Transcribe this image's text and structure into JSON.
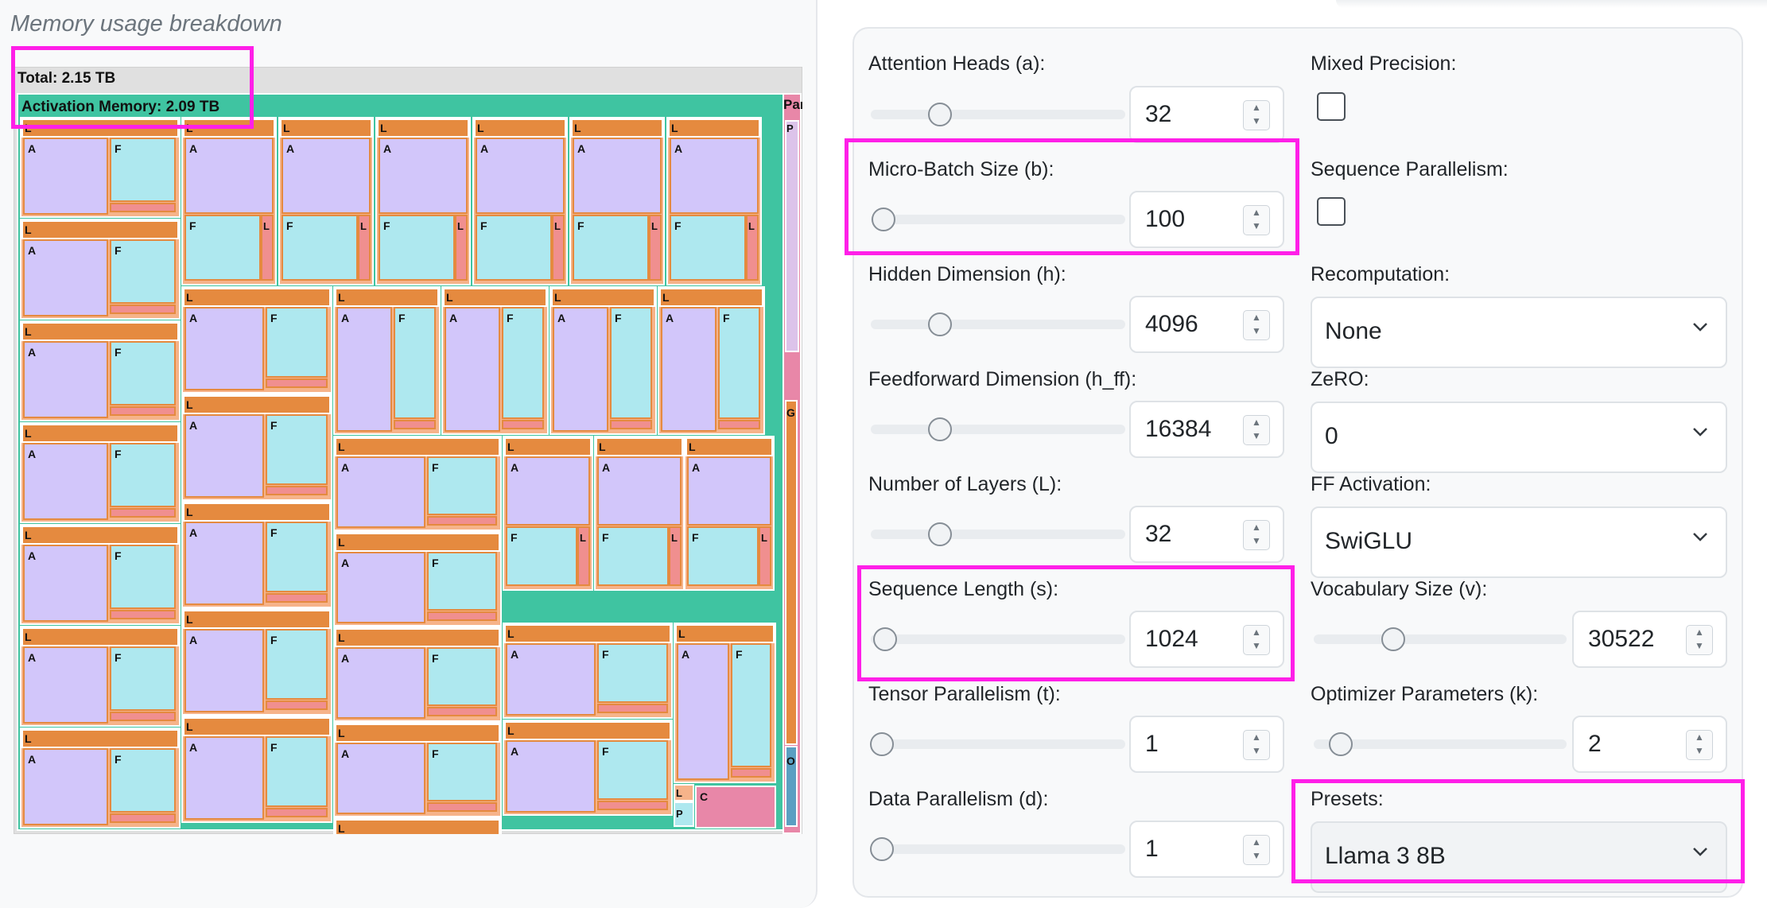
{
  "memory_panel": {
    "title": "Memory usage breakdown",
    "total_label": "Total: 2.15 TB",
    "activation_label": "Activation Memory: 2.09 TB",
    "param_label": "Par",
    "param_sub_label": "P",
    "grad_label": "G",
    "opt_label": "O",
    "layer_letter": "L",
    "attn_letter": "A",
    "ff_letter": "F",
    "c_letter": "C",
    "p_letter": "P"
  },
  "controls": {
    "attention_heads": {
      "label": "Attention Heads (a):",
      "value": "32",
      "fraction": 0.27
    },
    "micro_batch": {
      "label": "Micro-Batch Size (b):",
      "value": "100",
      "fraction": 0.02
    },
    "hidden_dim": {
      "label": "Hidden Dimension (h):",
      "value": "4096",
      "fraction": 0.27
    },
    "ff_dim": {
      "label": "Feedforward Dimension (h_ff):",
      "value": "16384",
      "fraction": 0.27
    },
    "num_layers": {
      "label": "Number of Layers (L):",
      "value": "32",
      "fraction": 0.27
    },
    "seq_len": {
      "label": "Sequence Length (s):",
      "value": "1024",
      "fraction": 0.02
    },
    "tensor_par": {
      "label": "Tensor Parallelism (t):",
      "value": "1",
      "fraction": 0.0
    },
    "data_par": {
      "label": "Data Parallelism (d):",
      "value": "1",
      "fraction": 0.0
    },
    "mixed_precision": {
      "label": "Mixed Precision:",
      "checked": false
    },
    "seq_parallelism": {
      "label": "Sequence Parallelism:",
      "checked": false
    },
    "recomputation": {
      "label": "Recomputation:",
      "value": "None"
    },
    "zero": {
      "label": "ZeRO:",
      "value": "0"
    },
    "ff_activation": {
      "label": "FF Activation:",
      "value": "SwiGLU"
    },
    "vocab_size": {
      "label": "Vocabulary Size (v):",
      "value": "30522",
      "fraction": 0.32
    },
    "optimizer_params": {
      "label": "Optimizer Parameters (k):",
      "value": "2",
      "fraction": 0.1
    },
    "presets": {
      "label": "Presets:",
      "value": "Llama 3 8B"
    }
  },
  "colors": {
    "total": "#e0e0e0",
    "activation": "#3fc4a1",
    "layer": "#e58a3f",
    "attention": "#d2c6fa",
    "feedforward": "#aee8ef",
    "param": "#e887a8",
    "highlight": "#ff1fe8"
  }
}
